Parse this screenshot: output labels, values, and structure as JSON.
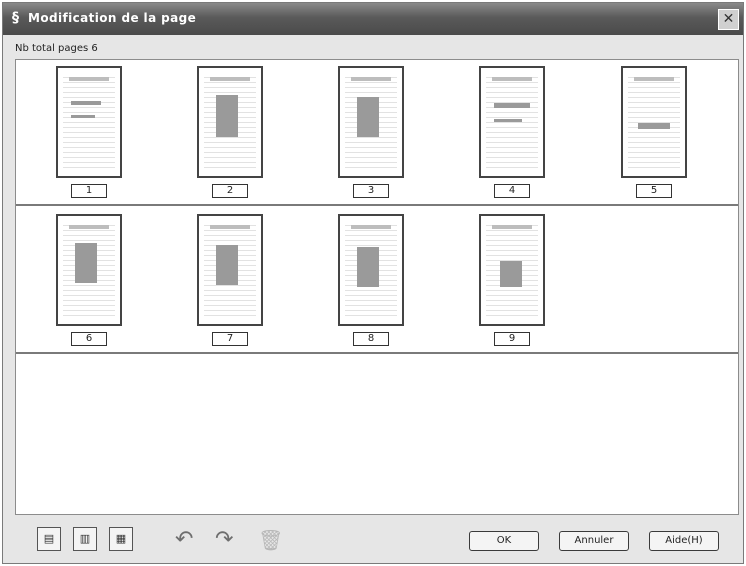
{
  "window": {
    "title": "Modification de la page",
    "close_symbol": "✕",
    "title_icon": "§"
  },
  "total_pages_label": "Nb total pages 6",
  "pages": [
    {
      "number": "1"
    },
    {
      "number": "2"
    },
    {
      "number": "3"
    },
    {
      "number": "4"
    },
    {
      "number": "5"
    },
    {
      "number": "6"
    },
    {
      "number": "7"
    },
    {
      "number": "8"
    },
    {
      "number": "9"
    }
  ],
  "toolbar": {
    "buttons": [
      {
        "name": "page-view-1-icon",
        "glyph": "▤"
      },
      {
        "name": "page-view-2-icon",
        "glyph": "▥"
      },
      {
        "name": "page-view-3-icon",
        "glyph": "▦"
      }
    ],
    "rotate_left_glyph": "↶",
    "rotate_right_glyph": "↷",
    "delete_glyph": "🗑"
  },
  "buttons": {
    "ok": "OK",
    "cancel": "Annuler",
    "help": "Aide(H)"
  },
  "colors": {
    "titlebar": "#5a5a5a",
    "window_bg": "#e6e6e6",
    "viewer_bg": "#ffffff"
  }
}
